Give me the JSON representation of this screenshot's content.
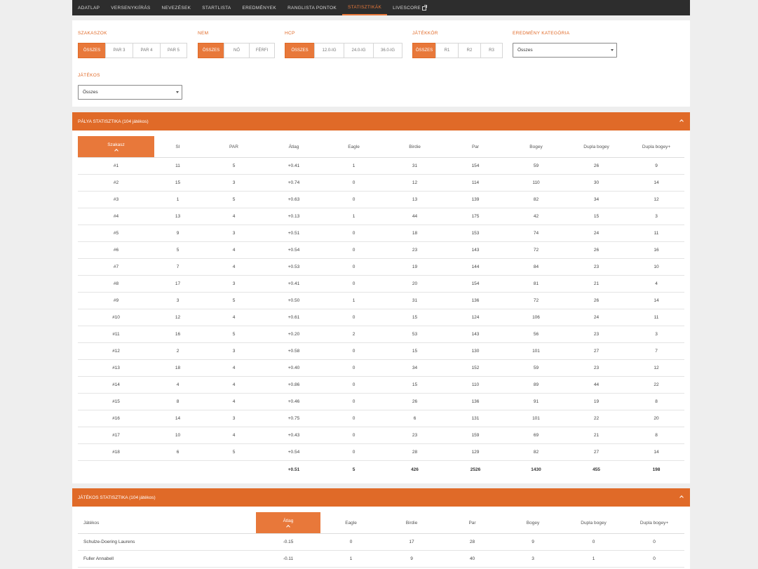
{
  "nav": {
    "items": [
      {
        "label": "ADATLAP",
        "active": false
      },
      {
        "label": "VERSENYKIÍRÁS",
        "active": false
      },
      {
        "label": "NEVEZÉSEK",
        "active": false
      },
      {
        "label": "STARTLISTA",
        "active": false
      },
      {
        "label": "EREDMÉNYEK",
        "active": false
      },
      {
        "label": "RANGLISTA PONTOK",
        "active": false
      },
      {
        "label": "STATISZTIKÁK",
        "active": true
      },
      {
        "label": "LIVESCORE",
        "active": false,
        "icon": "external-link-icon"
      }
    ]
  },
  "filters": {
    "szakaszok": {
      "label": "SZAKASZOK",
      "options": [
        "ÖSSZES",
        "PAR 3",
        "PAR 4",
        "PAR 5"
      ],
      "selected": 0
    },
    "nem": {
      "label": "NEM",
      "options": [
        "ÖSSZES",
        "NŐ",
        "FÉRFI"
      ],
      "selected": 0
    },
    "hcp": {
      "label": "HCP",
      "options": [
        "ÖSSZES",
        "12.0-IG",
        "24.0-IG",
        "36.0-IG"
      ],
      "selected": 0
    },
    "jatekkor": {
      "label": "JÁTÉKKÖR",
      "options": [
        "ÖSSZES",
        "R1",
        "R2",
        "R3"
      ],
      "selected": 0
    },
    "eredmeny": {
      "label": "EREDMÉNY KATEGÓRIA",
      "value": "Összes"
    },
    "jatekos": {
      "label": "JÁTÉKOS",
      "value": "Összes"
    }
  },
  "course_stats": {
    "title": "PÁLYA STATISZTIKA (104 játékos)",
    "headers": [
      "Szakasz",
      "SI",
      "PAR",
      "Átlag",
      "Eagle",
      "Birdie",
      "Par",
      "Bogey",
      "Dupla bogey",
      "Dupla bogey+"
    ],
    "rows": [
      [
        "#1",
        "11",
        "5",
        "+0.41",
        "1",
        "31",
        "154",
        "59",
        "26",
        "9"
      ],
      [
        "#2",
        "15",
        "3",
        "+0.74",
        "0",
        "12",
        "114",
        "110",
        "30",
        "14"
      ],
      [
        "#3",
        "1",
        "5",
        "+0.63",
        "0",
        "13",
        "139",
        "82",
        "34",
        "12"
      ],
      [
        "#4",
        "13",
        "4",
        "+0.13",
        "1",
        "44",
        "175",
        "42",
        "15",
        "3"
      ],
      [
        "#5",
        "9",
        "3",
        "+0.51",
        "0",
        "18",
        "153",
        "74",
        "24",
        "11"
      ],
      [
        "#6",
        "5",
        "4",
        "+0.54",
        "0",
        "23",
        "143",
        "72",
        "26",
        "16"
      ],
      [
        "#7",
        "7",
        "4",
        "+0.53",
        "0",
        "19",
        "144",
        "84",
        "23",
        "10"
      ],
      [
        "#8",
        "17",
        "3",
        "+0.41",
        "0",
        "20",
        "154",
        "81",
        "21",
        "4"
      ],
      [
        "#9",
        "3",
        "5",
        "+0.50",
        "1",
        "31",
        "136",
        "72",
        "26",
        "14"
      ],
      [
        "#10",
        "12",
        "4",
        "+0.61",
        "0",
        "15",
        "124",
        "106",
        "24",
        "11"
      ],
      [
        "#11",
        "16",
        "5",
        "+0.20",
        "2",
        "53",
        "143",
        "56",
        "23",
        "3"
      ],
      [
        "#12",
        "2",
        "3",
        "+0.58",
        "0",
        "15",
        "130",
        "101",
        "27",
        "7"
      ],
      [
        "#13",
        "18",
        "4",
        "+0.40",
        "0",
        "34",
        "152",
        "59",
        "23",
        "12"
      ],
      [
        "#14",
        "4",
        "4",
        "+0.86",
        "0",
        "15",
        "110",
        "89",
        "44",
        "22"
      ],
      [
        "#15",
        "8",
        "4",
        "+0.46",
        "0",
        "26",
        "136",
        "91",
        "19",
        "8"
      ],
      [
        "#16",
        "14",
        "3",
        "+0.75",
        "0",
        "6",
        "131",
        "101",
        "22",
        "20"
      ],
      [
        "#17",
        "10",
        "4",
        "+0.43",
        "0",
        "23",
        "159",
        "69",
        "21",
        "8"
      ],
      [
        "#18",
        "6",
        "5",
        "+0.54",
        "0",
        "28",
        "129",
        "82",
        "27",
        "14"
      ]
    ],
    "total": [
      "",
      "",
      "",
      "+0.51",
      "5",
      "426",
      "2526",
      "1430",
      "455",
      "198"
    ]
  },
  "player_stats": {
    "title": "JÁTÉKOS STATISZTIKA (104 játékos)",
    "headers": [
      "Játékos",
      "Átlag",
      "Eagle",
      "Birdie",
      "Par",
      "Bogey",
      "Dupla bogey",
      "Dupla bogey+"
    ],
    "rows": [
      [
        "Schulze-Doering Laurens",
        "-0.15",
        "0",
        "17",
        "28",
        "9",
        "0",
        "0"
      ],
      [
        "Fuller Annabell",
        "-0.11",
        "1",
        "9",
        "40",
        "3",
        "1",
        "0"
      ]
    ]
  },
  "colors": {
    "accent": "#e06a28",
    "nav_bg": "#2d2d2d"
  }
}
